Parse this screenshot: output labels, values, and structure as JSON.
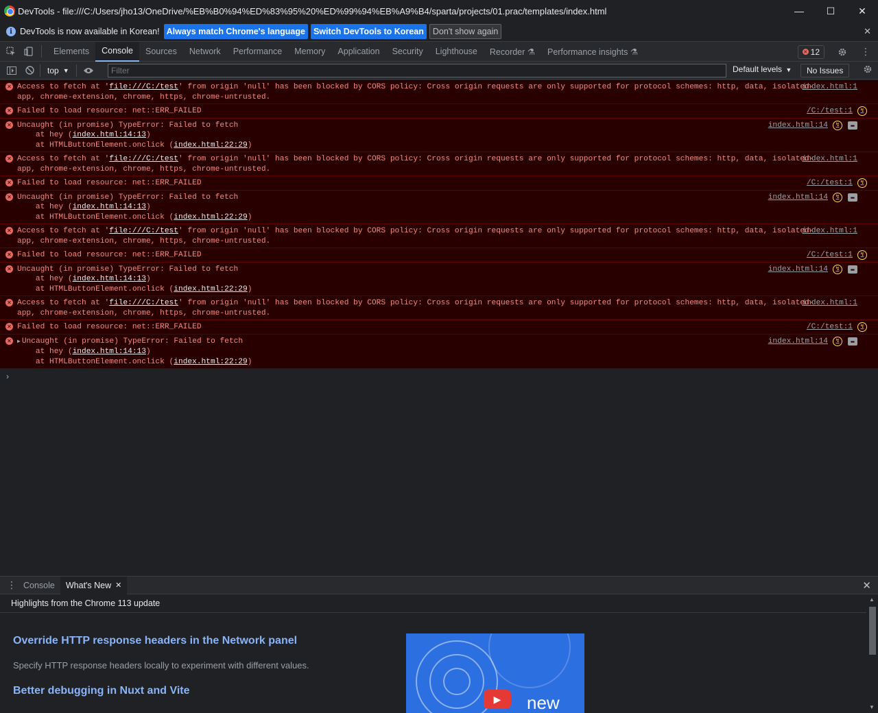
{
  "window": {
    "title": "DevTools - file:///C:/Users/jho13/OneDrive/%EB%B0%94%ED%83%95%20%ED%99%94%EB%A9%B4/sparta/projects/01.prac/templates/index.html",
    "minimize": "—",
    "maximize": "☐",
    "close": "✕"
  },
  "infobar": {
    "message": "DevTools is now available in Korean!",
    "btn_match": "Always match Chrome's language",
    "btn_switch": "Switch DevTools to Korean",
    "btn_dismiss": "Don't show again",
    "close": "✕"
  },
  "tabs": [
    "Elements",
    "Console",
    "Sources",
    "Network",
    "Performance",
    "Memory",
    "Application",
    "Security",
    "Lighthouse",
    "Recorder ⚗",
    "Performance insights ⚗"
  ],
  "error_count": "12",
  "console_toolbar": {
    "context": "top",
    "filter_placeholder": "Filter",
    "levels": "Default levels",
    "issues": "No Issues"
  },
  "messages": {
    "cors_prefix": "Access to fetch at '",
    "cors_url": "file:///C:/test",
    "cors_rest": "' from origin 'null' has been blocked by CORS policy: Cross origin requests are only supported for protocol schemes: http, data, isolated-",
    "cors_line2": "app, chrome-extension, chrome, https, chrome-untrusted.",
    "cors_src": "index.html:1",
    "failed": "Failed to load resource: net::ERR_FAILED",
    "failed_src": "/C:/test:1",
    "uncaught": "Uncaught (in promise) TypeError: Failed to fetch",
    "at_hey": "    at hey (",
    "at_hey_link": "index.html:14:13",
    "at_onclick": "    at HTMLButtonElement.onclick (",
    "at_onclick_link": "index.html:22:29",
    "close_paren": ")",
    "uncaught_src": "index.html:14"
  },
  "drawer": {
    "tab_console": "Console",
    "tab_whatsnew": "What's New",
    "highlights": "Highlights from the Chrome 113 update",
    "heading1": "Override HTTP response headers in the Network panel",
    "desc1": "Specify HTTP response headers locally to experiment with different values.",
    "heading2": "Better debugging in Nuxt and Vite",
    "video_text": "new"
  }
}
